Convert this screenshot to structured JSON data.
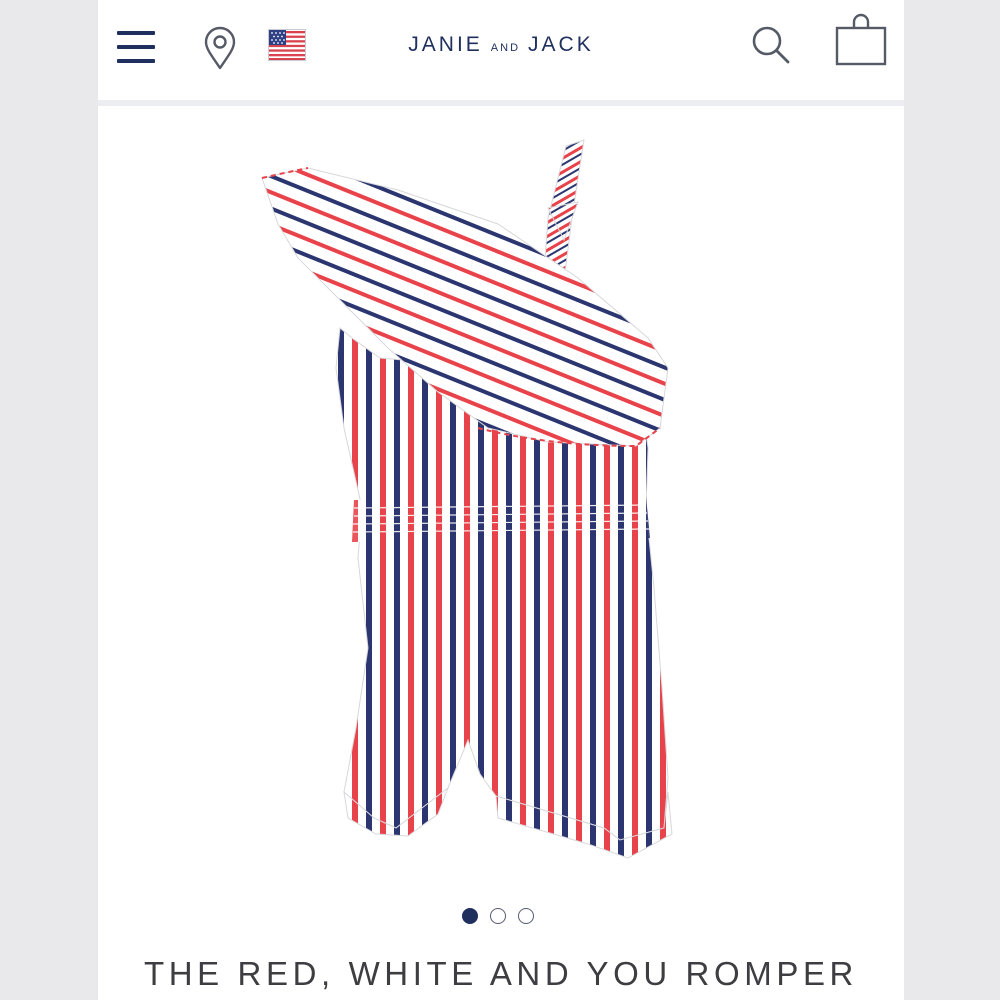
{
  "header": {
    "brand_primary": "JANIE",
    "brand_connector": "AND",
    "brand_secondary": "JACK",
    "icons": [
      "hamburger-menu-icon",
      "location-pin-icon",
      "us-flag-icon",
      "search-icon",
      "shopping-bag-icon"
    ]
  },
  "product": {
    "title": "THE RED, WHITE AND YOU ROMPER",
    "image_alt": "Red, white and navy striped one-shoulder ruffle romper"
  },
  "carousel": {
    "total": 3,
    "active_index": 1
  },
  "colors": {
    "navy": "#1f2f5e",
    "red": "#e8434a",
    "stripe_navy": "#2b3670",
    "background": "#ffffff",
    "title_text": "#3d3d42"
  }
}
